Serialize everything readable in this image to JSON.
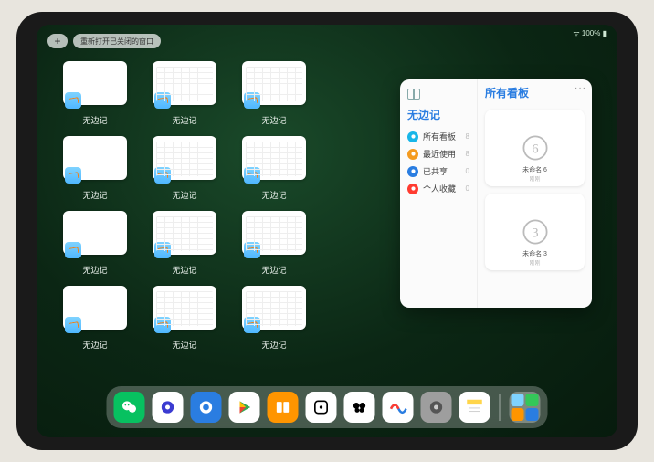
{
  "status": {
    "text": "100%"
  },
  "topbar": {
    "recent_closed": "重新打开已关闭的窗口",
    "add": "+"
  },
  "app_switcher": {
    "app_title": "无边记",
    "tiles": [
      {
        "variant": "plain",
        "label": "无边记"
      },
      {
        "variant": "calendar",
        "label": "无边记"
      },
      {
        "variant": "calendar",
        "label": "无边记"
      },
      {
        "variant": "blank"
      },
      {
        "variant": "plain",
        "label": "无边记"
      },
      {
        "variant": "calendar",
        "label": "无边记"
      },
      {
        "variant": "calendar",
        "label": "无边记"
      },
      {
        "variant": "blank"
      },
      {
        "variant": "plain",
        "label": "无边记"
      },
      {
        "variant": "calendar",
        "label": "无边记"
      },
      {
        "variant": "calendar",
        "label": "无边记"
      },
      {
        "variant": "blank"
      },
      {
        "variant": "plain",
        "label": "无边记"
      },
      {
        "variant": "calendar",
        "label": "无边记"
      },
      {
        "variant": "calendar",
        "label": "无边记"
      },
      {
        "variant": "blank"
      }
    ]
  },
  "overlay": {
    "title": "无边记",
    "boards_heading": "所有看板",
    "more": "···",
    "sidebar": [
      {
        "color": "#18b6e8",
        "label": "所有看板",
        "count": "8"
      },
      {
        "color": "#f49b20",
        "label": "最近使用",
        "count": "8"
      },
      {
        "color": "#2a7de1",
        "label": "已共享",
        "count": "0"
      },
      {
        "color": "#ff3b30",
        "label": "个人收藏",
        "count": "0"
      }
    ],
    "boards": [
      {
        "name": "未命名 6",
        "numeral": "6"
      },
      {
        "name": "未命名 3",
        "numeral": "3"
      }
    ]
  },
  "dock": {
    "apps": [
      {
        "name": "wechat",
        "bg": "#07c160"
      },
      {
        "name": "quark",
        "bg": "#ffffff"
      },
      {
        "name": "qqbrowser",
        "bg": "#2a7de1"
      },
      {
        "name": "play",
        "bg": "#ffffff"
      },
      {
        "name": "books",
        "bg": "#ff9500"
      },
      {
        "name": "dice",
        "bg": "#ffffff"
      },
      {
        "name": "butterfly",
        "bg": "#ffffff"
      },
      {
        "name": "freeform",
        "bg": "#ffffff"
      },
      {
        "name": "settings",
        "bg": "#9e9e9e"
      },
      {
        "name": "notes",
        "bg": "#ffffff"
      }
    ]
  }
}
